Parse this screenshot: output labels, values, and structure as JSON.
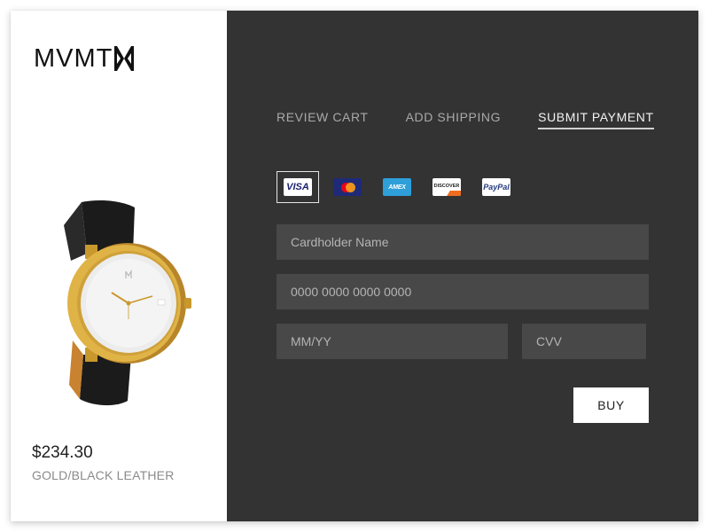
{
  "brand": {
    "logo_text": "MVMT"
  },
  "product": {
    "price": "$234.30",
    "variant": "GOLD/BLACK LEATHER",
    "image_icon": "watch-image"
  },
  "steps": [
    {
      "label": "REVIEW CART",
      "active": false
    },
    {
      "label": "ADD SHIPPING",
      "active": false
    },
    {
      "label": "SUBMIT PAYMENT",
      "active": true
    }
  ],
  "payment_methods": [
    {
      "label": "VISA",
      "icon": "visa-icon",
      "selected": true
    },
    {
      "label": "",
      "icon": "mastercard-icon",
      "selected": false
    },
    {
      "label": "AMEX",
      "icon": "amex-icon",
      "selected": false
    },
    {
      "label": "DISCOVER",
      "icon": "discover-icon",
      "selected": false
    },
    {
      "label": "PayPal",
      "icon": "paypal-icon",
      "selected": false
    }
  ],
  "form": {
    "cardholder_placeholder": "Cardholder Name",
    "cardholder_value": "",
    "number_placeholder": "0000 0000 0000 0000",
    "number_value": "",
    "expiry_placeholder": "MM/YY",
    "expiry_value": "",
    "cvv_placeholder": "CVV",
    "cvv_value": ""
  },
  "buy_label": "BUY",
  "colors": {
    "panel_dark": "#333333",
    "input_bg": "#484848",
    "accent_gold": "#d4a52c"
  }
}
